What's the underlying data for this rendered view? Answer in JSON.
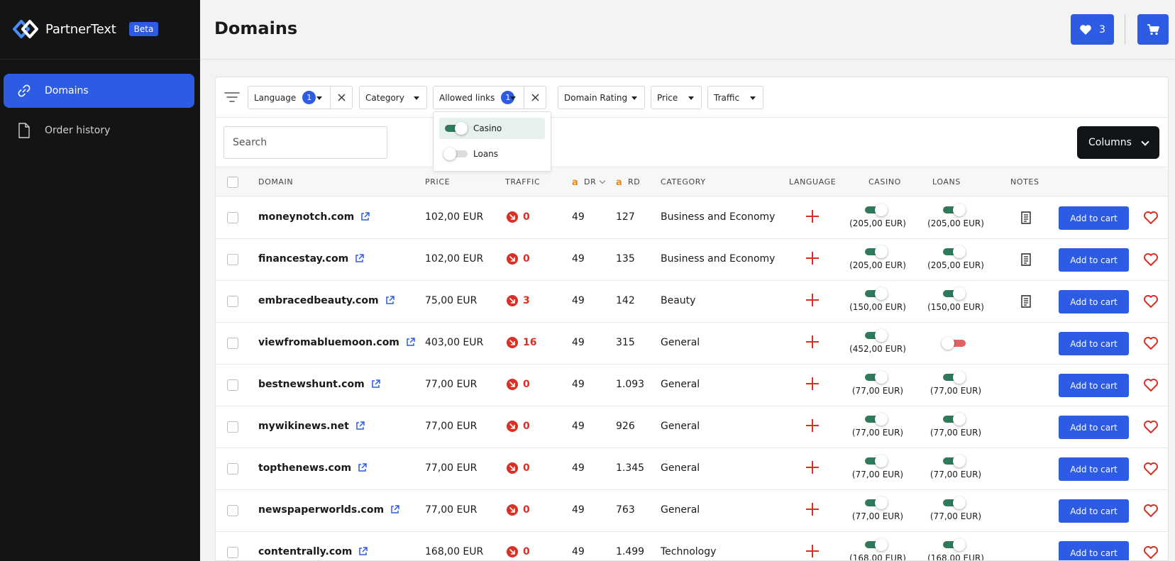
{
  "brand": {
    "name": "PartnerText",
    "badge": "Beta"
  },
  "sidebar": {
    "items": [
      {
        "label": "Domains",
        "icon": "link-icon",
        "active": true
      },
      {
        "label": "Order history",
        "icon": "document-icon",
        "active": false
      }
    ]
  },
  "header": {
    "title": "Domains",
    "favorites_count": "3"
  },
  "filters": {
    "language": {
      "label": "Language",
      "count": "1"
    },
    "category": {
      "label": "Category"
    },
    "allowed_links": {
      "label": "Allowed links",
      "count": "1"
    },
    "domain_rating": {
      "label": "Domain Rating"
    },
    "price": {
      "label": "Price"
    },
    "traffic": {
      "label": "Traffic"
    }
  },
  "dropdown": {
    "options": [
      {
        "label": "Casino",
        "on": true
      },
      {
        "label": "Loans",
        "on": false
      }
    ]
  },
  "search": {
    "placeholder": "Search"
  },
  "columns_button": "Columns",
  "table": {
    "headers": {
      "domain": "DOMAIN",
      "price": "PRICE",
      "traffic": "TRAFFIC",
      "dr": "DR",
      "rd": "RD",
      "category": "CATEGORY",
      "language": "LANGUAGE",
      "casino": "CASINO",
      "loans": "LOANS",
      "notes": "NOTES"
    },
    "add_label": "Add to cart",
    "rows": [
      {
        "domain": "moneynotch.com",
        "price": "102,00 EUR",
        "traffic": "0",
        "dr": "49",
        "rd": "127",
        "category": "Business and Economy",
        "casino": "(205,00 EUR)",
        "loans": "(205,00 EUR)",
        "loans_on": true,
        "notes": true
      },
      {
        "domain": "financestay.com",
        "price": "102,00 EUR",
        "traffic": "0",
        "dr": "49",
        "rd": "135",
        "category": "Business and Economy",
        "casino": "(205,00 EUR)",
        "loans": "(205,00 EUR)",
        "loans_on": true,
        "notes": true
      },
      {
        "domain": "embracedbeauty.com",
        "price": "75,00 EUR",
        "traffic": "3",
        "dr": "49",
        "rd": "142",
        "category": "Beauty",
        "casino": "(150,00 EUR)",
        "loans": "(150,00 EUR)",
        "loans_on": true,
        "notes": true
      },
      {
        "domain": "viewfromabluemoon.com",
        "price": "403,00 EUR",
        "traffic": "16",
        "dr": "49",
        "rd": "315",
        "category": "General",
        "casino": "(452,00 EUR)",
        "loans": "",
        "loans_on": false,
        "notes": false
      },
      {
        "domain": "bestnewshunt.com",
        "price": "77,00 EUR",
        "traffic": "0",
        "dr": "49",
        "rd": "1.093",
        "category": "General",
        "casino": "(77,00 EUR)",
        "loans": "(77,00 EUR)",
        "loans_on": true,
        "notes": false
      },
      {
        "domain": "mywikinews.net",
        "price": "77,00 EUR",
        "traffic": "0",
        "dr": "49",
        "rd": "926",
        "category": "General",
        "casino": "(77,00 EUR)",
        "loans": "(77,00 EUR)",
        "loans_on": true,
        "notes": false
      },
      {
        "domain": "topthenews.com",
        "price": "77,00 EUR",
        "traffic": "0",
        "dr": "49",
        "rd": "1.345",
        "category": "General",
        "casino": "(77,00 EUR)",
        "loans": "(77,00 EUR)",
        "loans_on": true,
        "notes": false
      },
      {
        "domain": "newspaperworlds.com",
        "price": "77,00 EUR",
        "traffic": "0",
        "dr": "49",
        "rd": "763",
        "category": "General",
        "casino": "(77,00 EUR)",
        "loans": "(77,00 EUR)",
        "loans_on": true,
        "notes": false
      },
      {
        "domain": "contentrally.com",
        "price": "168,00 EUR",
        "traffic": "0",
        "dr": "49",
        "rd": "1.499",
        "category": "Technology",
        "casino": "(168,00 EUR)",
        "loans": "(168,00 EUR)",
        "loans_on": true,
        "notes": false
      }
    ]
  }
}
